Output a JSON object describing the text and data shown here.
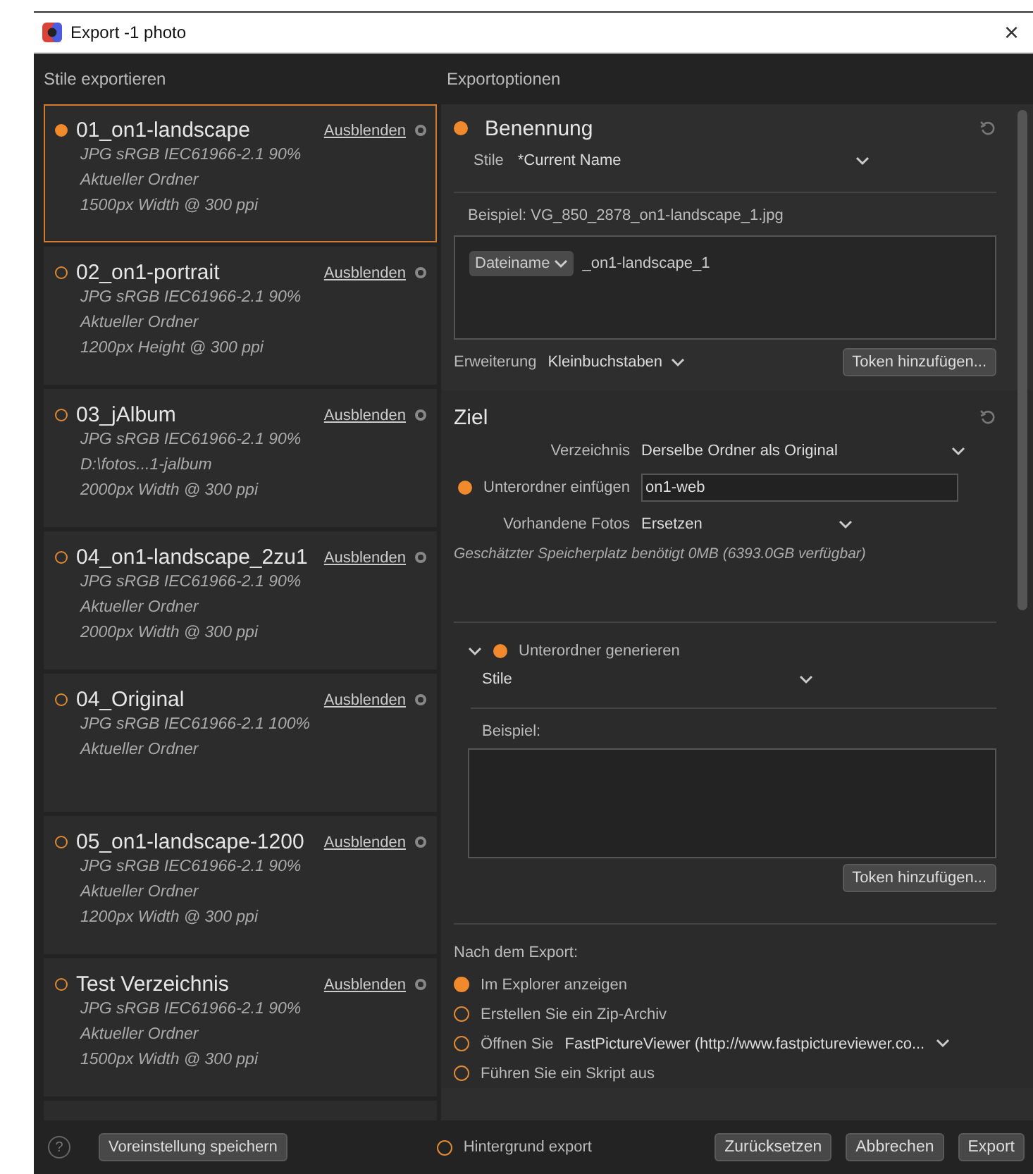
{
  "window": {
    "title": "Export -1 photo",
    "close": "×"
  },
  "styles_panel": {
    "heading": "Stile exportieren",
    "styles": [
      {
        "name": "01_on1-landscape",
        "selected": true,
        "hide_link": "Ausblenden",
        "lines": [
          "JPG  sRGB IEC61966-2.1  90%",
          "Aktueller Ordner",
          "1500px Width @ 300 ppi"
        ]
      },
      {
        "name": "02_on1-portrait",
        "selected": false,
        "hide_link": "Ausblenden",
        "lines": [
          "JPG  sRGB IEC61966-2.1  90%",
          "Aktueller Ordner",
          "1200px Height @ 300 ppi"
        ]
      },
      {
        "name": "03_jAlbum",
        "selected": false,
        "hide_link": "Ausblenden",
        "lines": [
          "JPG  sRGB IEC61966-2.1  90%",
          "D:\\fotos...1-jalbum",
          "2000px Width @ 300 ppi"
        ]
      },
      {
        "name": "04_on1-landscape_2zu1",
        "selected": false,
        "hide_link": "Ausblenden",
        "lines": [
          "JPG  sRGB IEC61966-2.1  90%",
          "Aktueller Ordner",
          "2000px Width @ 300 ppi"
        ]
      },
      {
        "name": "04_Original",
        "selected": false,
        "hide_link": "Ausblenden",
        "lines": [
          "JPG  sRGB IEC61966-2.1  100%",
          "Aktueller Ordner"
        ]
      },
      {
        "name": "05_on1-landscape-1200",
        "selected": false,
        "hide_link": "Ausblenden",
        "lines": [
          "JPG  sRGB IEC61966-2.1  90%",
          "Aktueller Ordner",
          "1200px Width @ 300 ppi"
        ]
      },
      {
        "name": "Test Verzeichnis",
        "selected": false,
        "hide_link": "Ausblenden",
        "lines": [
          "JPG  sRGB IEC61966-2.1  90%",
          "Aktueller Ordner",
          "1500px Width @ 300 ppi"
        ]
      }
    ]
  },
  "options_panel": {
    "heading": "Exportoptionen",
    "naming": {
      "title": "Benennung",
      "on": true,
      "style_label": "Stile",
      "style_value": "*Current Name",
      "example": "Beispiel: VG_850_2878_on1-landscape_1.jpg",
      "token_chip": "Dateiname",
      "token_text": "_on1-landscape_1",
      "extension_label": "Erweiterung",
      "extension_value": "Kleinbuchstaben",
      "token_button": "Token hinzufügen..."
    },
    "target": {
      "title": "Ziel",
      "directory_label": "Verzeichnis",
      "directory_value": "Derselbe Ordner als Original",
      "subfolder_on": true,
      "subfolder_label": "Unterordner einfügen",
      "subfolder_value": "on1-web",
      "existing_label": "Vorhandene Fotos",
      "existing_value": "Ersetzen",
      "space_note": "Geschätzter Speicherplatz benötigt 0MB (6393.0GB verfügbar)"
    },
    "generate": {
      "expanded": true,
      "on": true,
      "label": "Unterordner generieren",
      "style_value": "Stile",
      "example_label": "Beispiel:",
      "token_button": "Token hinzufügen..."
    },
    "after_export": {
      "label": "Nach dem Export:",
      "options": [
        {
          "label": "Im Explorer anzeigen",
          "selected": true
        },
        {
          "label": "Erstellen Sie ein Zip-Archiv",
          "selected": false
        },
        {
          "label": "Öffnen Sie",
          "selected": false,
          "app": "FastPictureViewer (http://www.fastpictureviewer.co..."
        },
        {
          "label": "Führen Sie ein Skript aus",
          "selected": false
        }
      ]
    }
  },
  "footer": {
    "help": "?",
    "save_preset": "Voreinstellung speichern",
    "background_export": {
      "label": "Hintergrund export",
      "selected": false
    },
    "buttons": [
      "Zurücksetzen",
      "Abbrechen",
      "Export"
    ]
  }
}
